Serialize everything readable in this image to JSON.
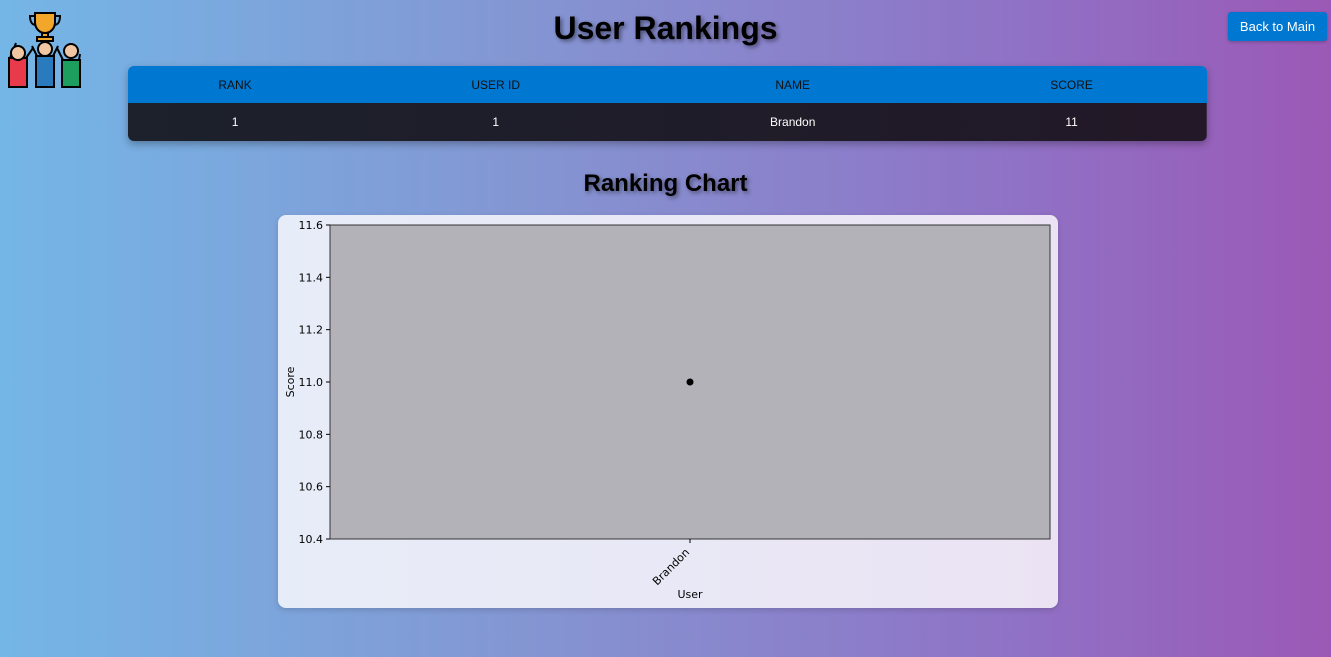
{
  "header": {
    "title": "User Rankings",
    "back_button_label": "Back to Main"
  },
  "table": {
    "columns": [
      "Rank",
      "User ID",
      "Name",
      "Score"
    ],
    "rows": [
      {
        "rank": "1",
        "user_id": "1",
        "name": "Brandon",
        "score": "11"
      }
    ]
  },
  "chart_section": {
    "title": "Ranking Chart"
  },
  "colors": {
    "accent": "#0077d0",
    "table_row": "#1c212b",
    "plot_bg": "#b3b2b9",
    "point": "#000000"
  },
  "chart_data": {
    "type": "scatter",
    "x": [
      "Brandon"
    ],
    "y": [
      11
    ],
    "xlabel": "User",
    "ylabel": "Score",
    "ylim": [
      10.4,
      11.6
    ],
    "yticks": [
      "10.4",
      "10.6",
      "10.8",
      "11.0",
      "11.2",
      "11.4",
      "11.6"
    ],
    "grid": false
  }
}
